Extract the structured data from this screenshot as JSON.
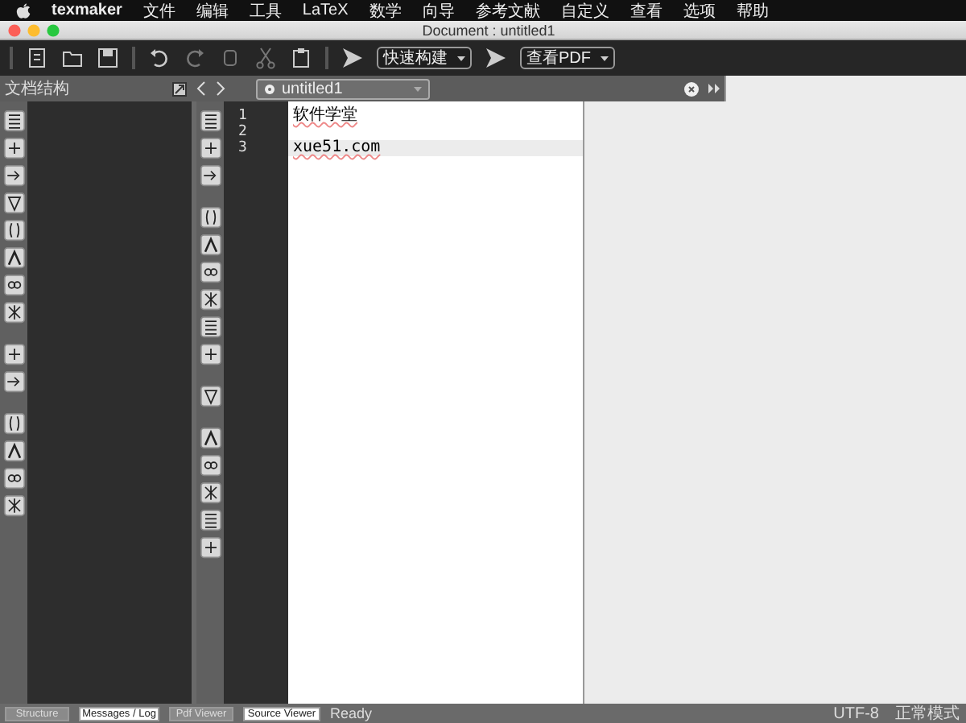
{
  "menu_bar": {
    "app": "texmaker",
    "items": [
      "文件",
      "编辑",
      "工具",
      "LaTeX",
      "数学",
      "向导",
      "参考文献",
      "自定义",
      "查看",
      "选项",
      "帮助"
    ]
  },
  "window": {
    "title": "Document : untitled1"
  },
  "toolbar": {
    "build_dropdown": "快速构建",
    "view_dropdown": "查看PDF"
  },
  "structure_panel": {
    "title": "文档结构"
  },
  "tabs": [
    {
      "label": "untitled1",
      "selected": true
    }
  ],
  "editor": {
    "lines": [
      {
        "number": "1",
        "text": "软件学堂",
        "current": false
      },
      {
        "number": "2",
        "current": false
      },
      {
        "number": "3",
        "text": "xue51.com",
        "current": true
      }
    ]
  },
  "status_bar": {
    "tabs": [
      {
        "label": "Structure",
        "selected": false
      },
      {
        "label": "Messages / Log",
        "selected": true
      },
      {
        "label": "Pdf Viewer",
        "selected": false
      },
      {
        "label": "Source Viewer",
        "selected": true
      }
    ],
    "message": "Ready",
    "encoding": "UTF-8",
    "mode": "正常模式"
  }
}
